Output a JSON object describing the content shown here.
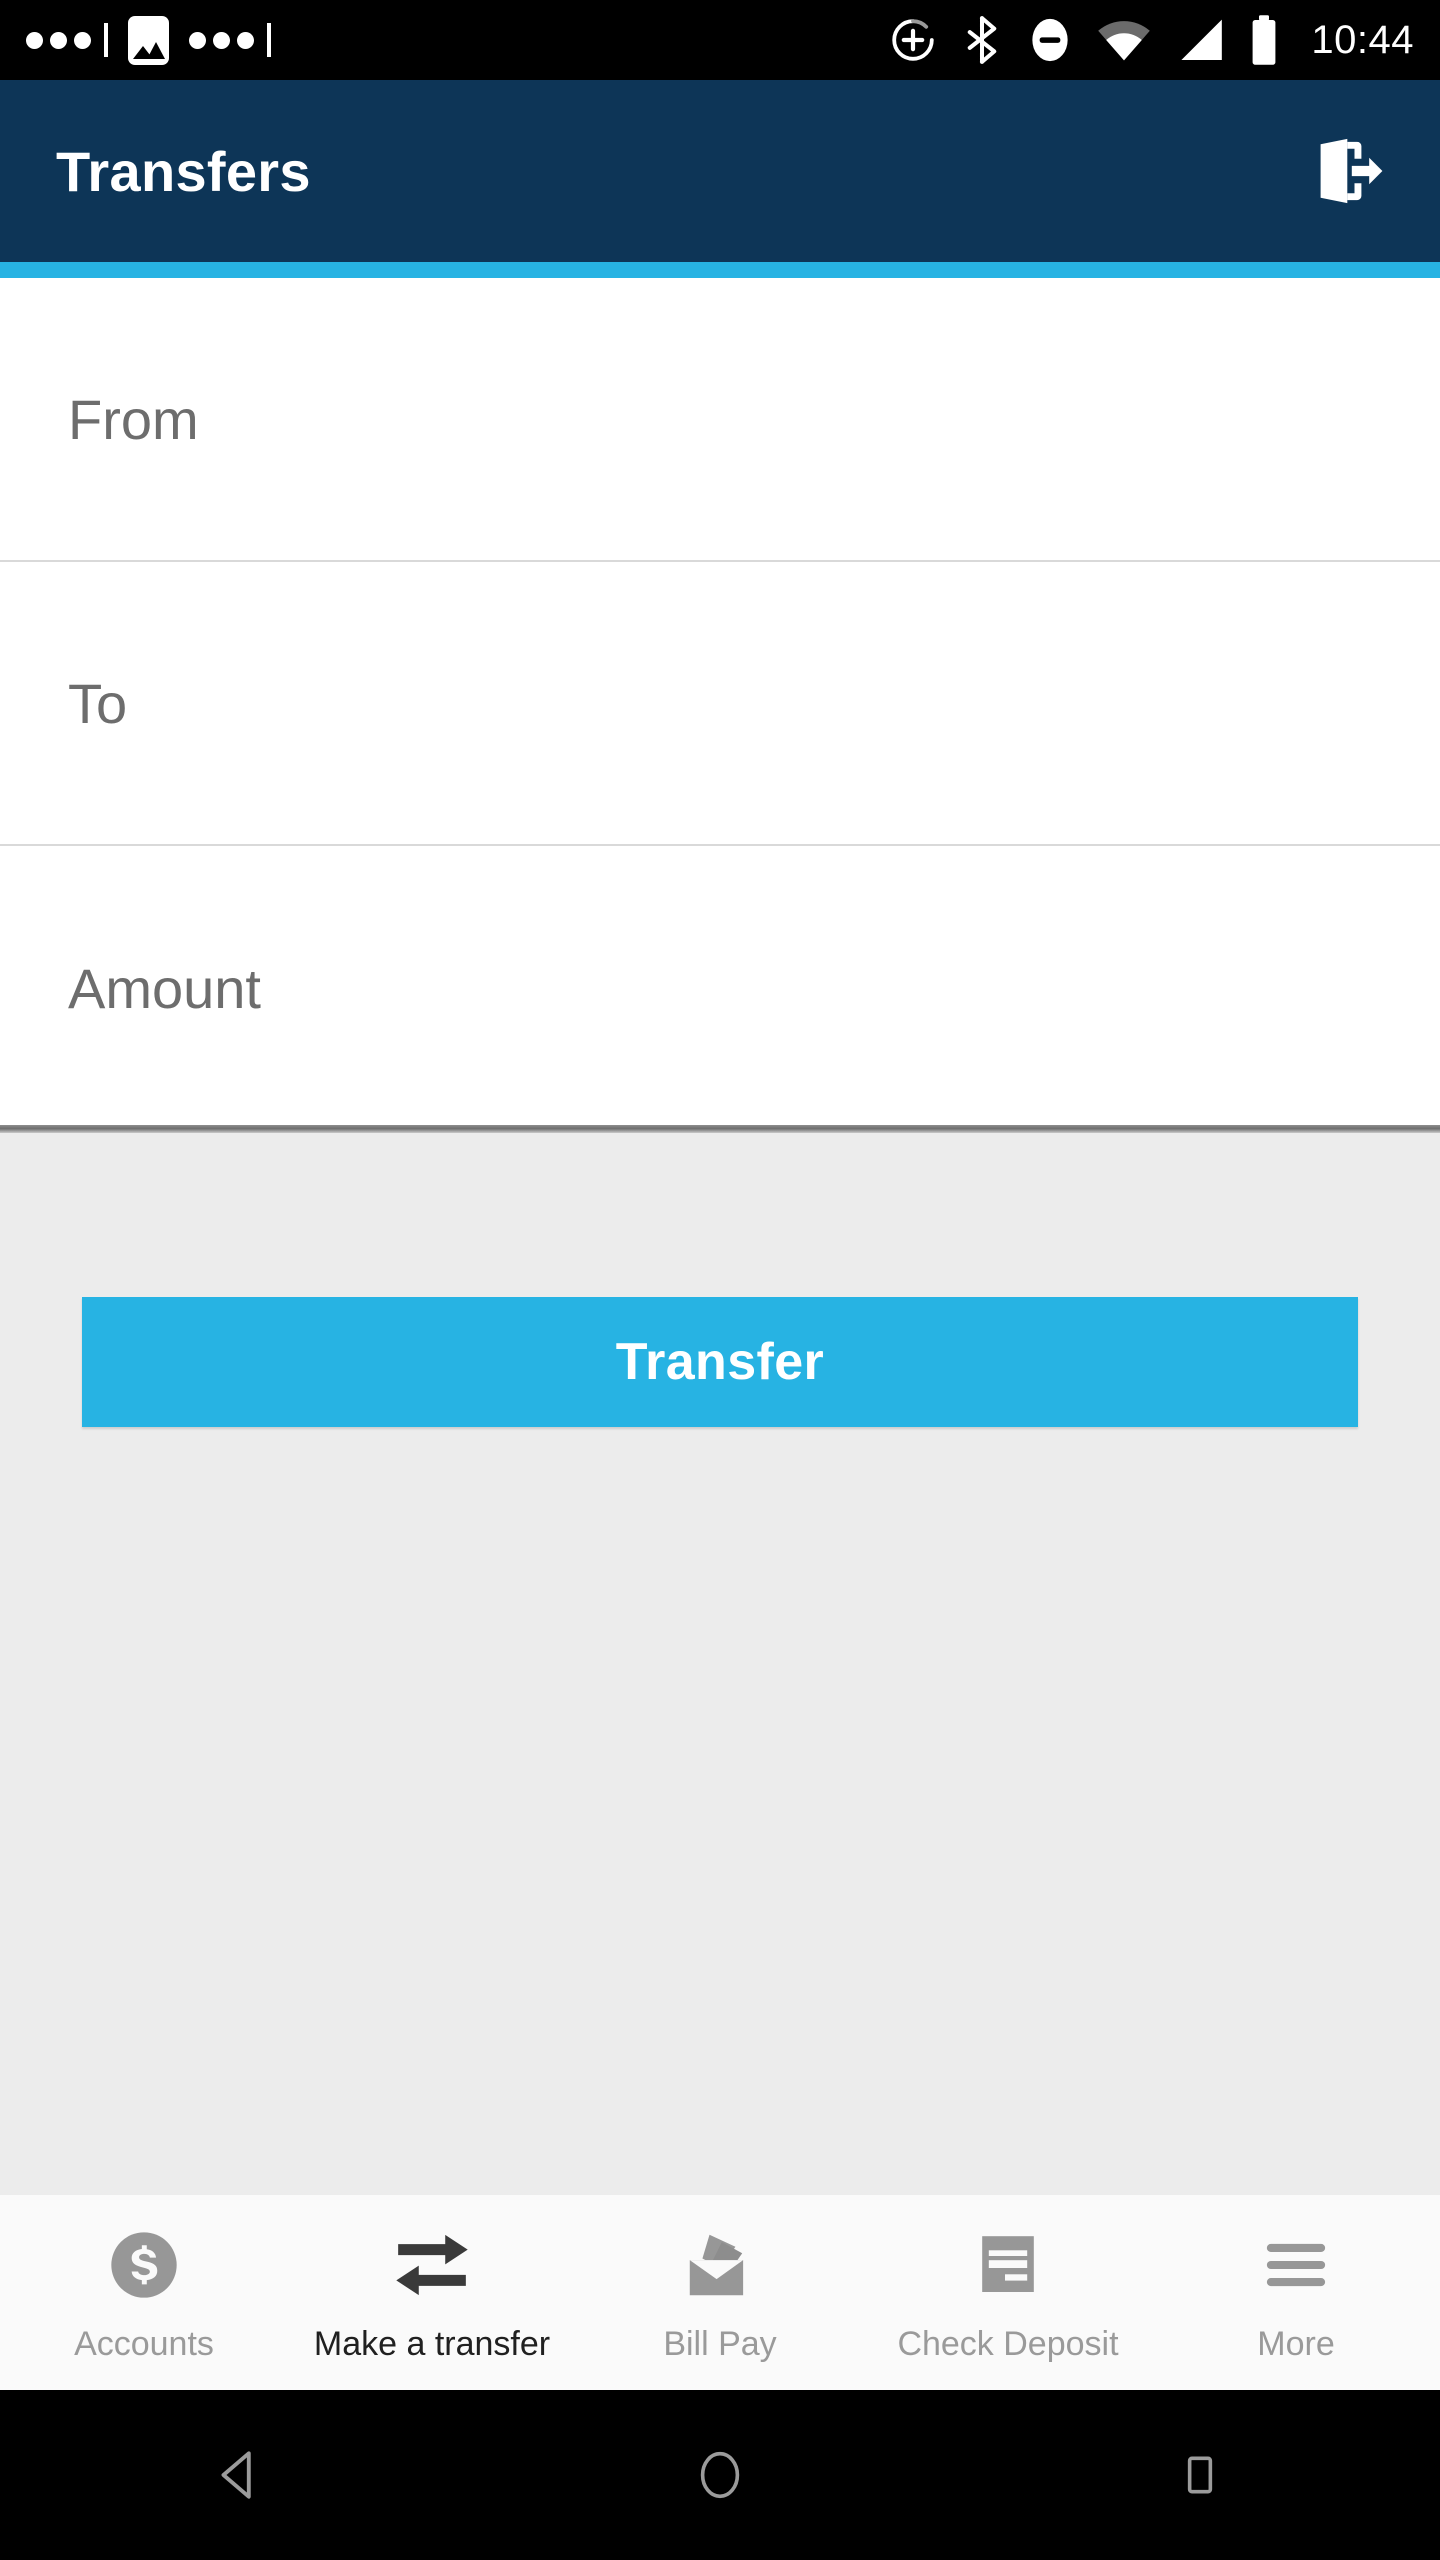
{
  "status_bar": {
    "time": "10:44",
    "notification_icons": [
      "dots-menu-icon",
      "photo-icon",
      "dots-menu-icon"
    ],
    "system_icons": [
      "cast-plus-icon",
      "bluetooth-icon",
      "do-not-disturb-icon",
      "wifi-icon",
      "cellular-signal-icon",
      "battery-icon"
    ],
    "background_color": "#000000"
  },
  "header": {
    "title": "Transfers",
    "logout_icon": "logout-door-icon",
    "background_color": "#0d3557",
    "accent_color": "#27b3e3"
  },
  "form": {
    "fields": [
      {
        "name": "from",
        "placeholder": "From",
        "value": ""
      },
      {
        "name": "to",
        "placeholder": "To",
        "value": ""
      },
      {
        "name": "amount",
        "placeholder": "Amount",
        "value": ""
      }
    ]
  },
  "actions": {
    "transfer_label": "Transfer",
    "transfer_color": "#27b3e3"
  },
  "content": {
    "background_color": "#ececec"
  },
  "tab_bar": {
    "background_color": "#fafafa",
    "active_index": 1,
    "inactive_color": "#9a9a9a",
    "active_color": "#202020",
    "tabs": [
      {
        "label": "Accounts",
        "icon": "dollar-circle-icon"
      },
      {
        "label": "Make a transfer",
        "icon": "transfer-arrows-icon"
      },
      {
        "label": "Bill Pay",
        "icon": "envelope-card-icon"
      },
      {
        "label": "Check Deposit",
        "icon": "check-document-icon"
      },
      {
        "label": "More",
        "icon": "hamburger-menu-icon"
      }
    ]
  },
  "android_nav": {
    "buttons": [
      "back-button",
      "home-button",
      "recents-button"
    ],
    "background_color": "#000000"
  }
}
